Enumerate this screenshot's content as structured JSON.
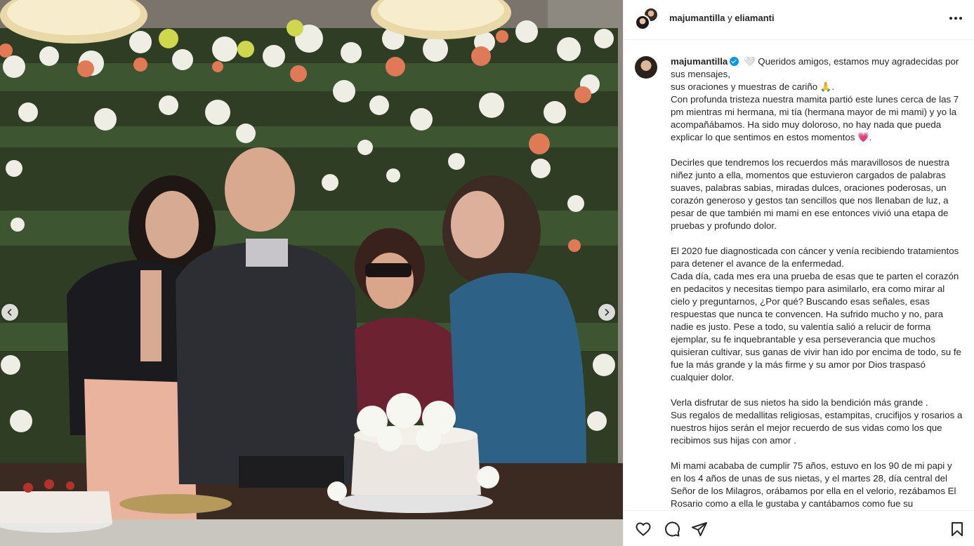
{
  "header": {
    "user1": "majumantilla",
    "joiner": "y",
    "user2": "eliamanti"
  },
  "caption": {
    "username": "majumantilla",
    "intro": "Queridos amigos, estamos muy agradecidas por sus mensajes,",
    "line2": "sus oraciones y muestras de cariño",
    "line2_end": ".",
    "p1": "Con profunda tristeza nuestra mamita partió este lunes cerca de las 7 pm mientras mi hermana, mi tía (hermana mayor de mi mami) y yo la acompañábamos. Ha sido muy doloroso, no hay nada que pueda explicar lo que sentimos en estos momentos",
    "p1_end": ".",
    "p2": "Decirles que tendremos los recuerdos  más maravillosos de nuestra niñez junto a ella, momentos que estuvieron cargados de palabras suaves, palabras sabias, miradas dulces, oraciones poderosas, un corazón generoso y gestos tan sencillos que nos llenaban de luz, a pesar de que también mi mami en ese entonces vivió una etapa de pruebas y profundo dolor.",
    "p3a": "El 2020 fue diagnosticada con cáncer y venía recibiendo tratamientos para detener el avance de la enfermedad.",
    "p3b": "Cada día, cada mes era una prueba de esas que te parten el corazón en pedacitos y necesitas tiempo para asimilarlo, era como mirar al cielo y preguntarnos, ¿Por qué? Buscando esas señales, esas respuestas que nunca te convencen. Ha sufrido mucho y no, para nadie es justo. Pese a todo, su valentía salió a relucir de forma ejemplar, su fe inquebrantable y esa perseverancia que muchos quisieran cultivar, sus ganas de vivir han ido por encima de todo, su fe fue la más grande y la más firme y su amor por Dios traspasó cualquier dolor.",
    "p4a": "Verla disfrutar de sus nietos ha sido la bendición más grande .",
    "p4b": "Sus regalos de medallitas religiosas, estampitas, crucifijos y rosarios a nuestros hijos serán el mejor recuerdo de sus vidas como los que recibimos sus hijas con amor .",
    "p5": "Mi mami acababa de cumplir 75 años, estuvo en los 90 de mi papi y en los 4 años de unas de sus nietas, y el martes 28, día central del Señor de los Milagros, orábamos por ella en el velorio, rezábamos El Rosario como a ella le gustaba y cantábamos como fue su"
  },
  "emojis": {
    "heart": "🤍",
    "pray": "🙏",
    "pink_heart": "💗"
  },
  "icons": {
    "more": "more-horizontal-icon",
    "prev": "chevron-left-icon",
    "next": "chevron-right-icon",
    "like": "heart-icon",
    "comment": "comment-bubble-icon",
    "share": "paper-plane-icon",
    "save": "bookmark-icon"
  },
  "colors": {
    "verified": "#0095f6",
    "text": "#262626",
    "border": "#efefef"
  }
}
